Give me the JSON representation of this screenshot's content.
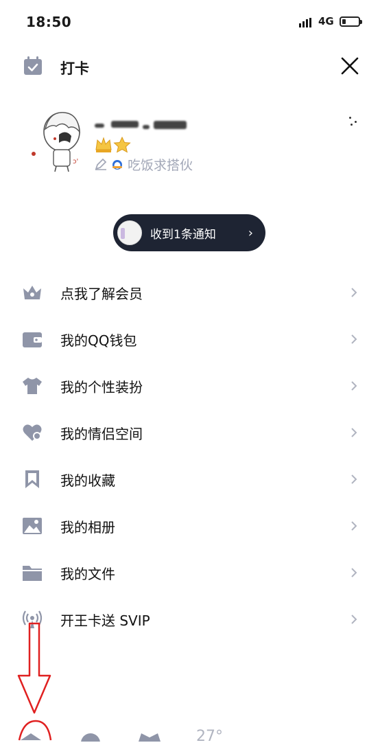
{
  "status_bar": {
    "time": "18:50",
    "network": "4G"
  },
  "header": {
    "checkin_label": "打卡"
  },
  "profile": {
    "status_text": "吃饭求搭伙"
  },
  "notification": {
    "text": "收到1条通知"
  },
  "menu": {
    "items": [
      {
        "label": "点我了解会员",
        "icon": "vip-crown-icon"
      },
      {
        "label": "我的QQ钱包",
        "icon": "wallet-icon"
      },
      {
        "label": "我的个性装扮",
        "icon": "tshirt-icon"
      },
      {
        "label": "我的情侣空间",
        "icon": "heart-icon"
      },
      {
        "label": "我的收藏",
        "icon": "bookmark-icon"
      },
      {
        "label": "我的相册",
        "icon": "photo-icon"
      },
      {
        "label": "我的文件",
        "icon": "folder-icon"
      },
      {
        "label": "开王卡送 SVIP",
        "icon": "signal-icon"
      }
    ]
  },
  "bottom_bar": {
    "weather_temp": "27°"
  },
  "colors": {
    "icon_gray": "#8f95a8",
    "pill_bg": "#1e2433",
    "annotation_red": "#e02020"
  }
}
